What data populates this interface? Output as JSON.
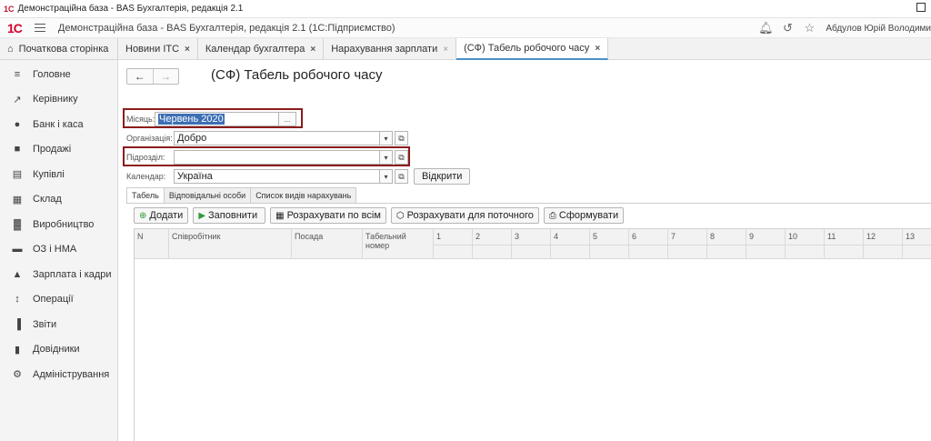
{
  "window": {
    "title": "Демонстраційна база - BAS Бухгалтерія, редакція 2.1"
  },
  "appbar": {
    "brand": "1С",
    "title": "Демонстраційна база - BAS Бухгалтерія, редакція 2.1  (1С:Підприємство)",
    "user": "Абдулов Юрій Володими"
  },
  "tabs": {
    "home": "Початкова сторінка",
    "items": [
      {
        "label": "Новини ІТС",
        "close": "×"
      },
      {
        "label": "Календар бухгалтера",
        "close": "×"
      },
      {
        "label": "Нарахування зарплати",
        "close": "×"
      },
      {
        "label": "(СФ) Табель робочого часу",
        "close": "×"
      }
    ]
  },
  "sidebar": {
    "items": [
      {
        "label": "Головне",
        "icon": "menu-lines-icon"
      },
      {
        "label": "Керівнику",
        "icon": "trend-icon"
      },
      {
        "label": "Банк і каса",
        "icon": "coin-icon"
      },
      {
        "label": "Продажі",
        "icon": "bag-icon"
      },
      {
        "label": "Купівлі",
        "icon": "cart-icon"
      },
      {
        "label": "Склад",
        "icon": "warehouse-icon"
      },
      {
        "label": "Виробництво",
        "icon": "factory-icon"
      },
      {
        "label": "ОЗ і НМА",
        "icon": "truck-icon"
      },
      {
        "label": "Зарплата і кадри",
        "icon": "person-icon"
      },
      {
        "label": "Операції",
        "icon": "operations-icon"
      },
      {
        "label": "Звіти",
        "icon": "bar-chart-icon"
      },
      {
        "label": "Довідники",
        "icon": "books-icon"
      },
      {
        "label": "Адміністрування",
        "icon": "gear-icon"
      }
    ]
  },
  "document": {
    "title": "(СФ) Табель робочого часу",
    "month_label": "Місяць:",
    "month_value": "Червень 2020",
    "org_label": "Організація:",
    "org_value": "Добро",
    "dept_label": "Підрозділ:",
    "dept_value": "",
    "calendar_label": "Календар:",
    "calendar_value": "Україна",
    "open_button": "Відкрити",
    "ellipsis": "..."
  },
  "subtabs": [
    "Табель",
    "Відповідальні особи",
    "Список видів нарахувань"
  ],
  "toolbar": {
    "add": "Додати",
    "fill": "Заповнити",
    "calc_all": "Розрахувати по всім",
    "calc_current": "Розрахувати для поточного",
    "form": "Сформувати"
  },
  "grid": {
    "columns": [
      "N",
      "Співробітник",
      "Посада",
      "Табельний номер"
    ],
    "days": [
      "1",
      "2",
      "3",
      "4",
      "5",
      "6",
      "7",
      "8",
      "9",
      "10",
      "11",
      "12",
      "13"
    ]
  },
  "colors": {
    "highlight_box": "#8b1c1c",
    "selection": "#3d6fb5",
    "brand": "#d4002a"
  }
}
